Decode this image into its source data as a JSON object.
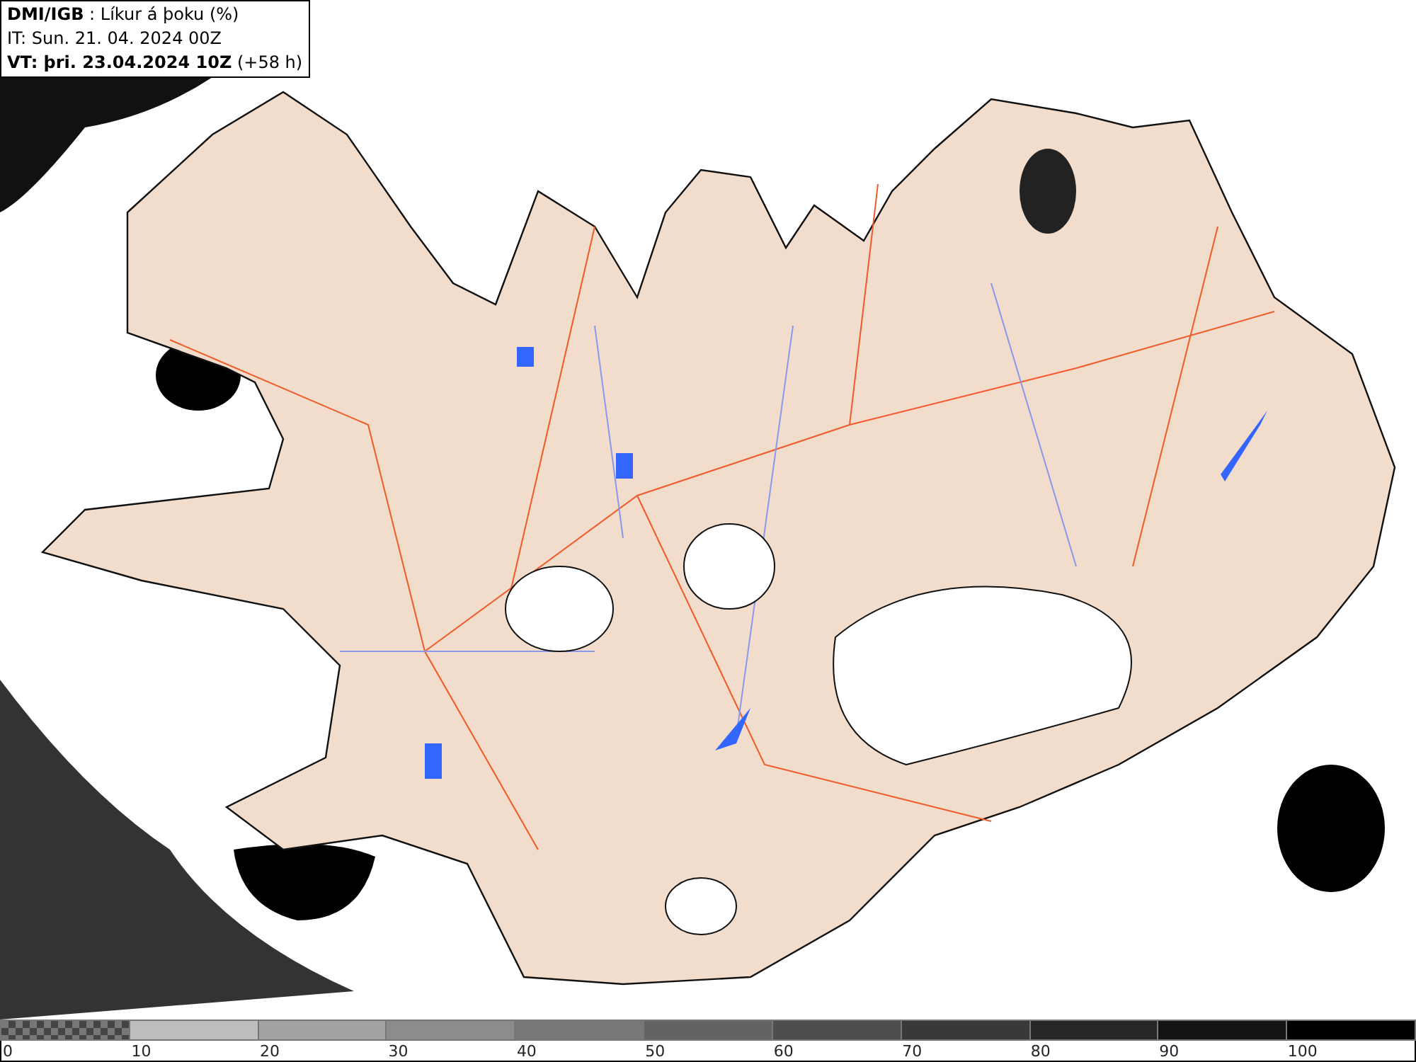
{
  "header": {
    "lines": [
      "**DMI/IGB** : Líkur á þoku (%)",
      "IT: Sun. 21. 04. 2024 00Z",
      "**VT: þri. 23.04.2024 10Z** (+58 h)"
    ]
  },
  "legend": {
    "bins": [
      {
        "kind": "checker"
      },
      {
        "kind": "solid",
        "color": "#bdbdbd"
      },
      {
        "kind": "solid",
        "color": "#a3a3a3"
      },
      {
        "kind": "solid",
        "color": "#8c8c8c"
      },
      {
        "kind": "solid",
        "color": "#787878"
      },
      {
        "kind": "solid",
        "color": "#636363"
      },
      {
        "kind": "solid",
        "color": "#4d4d4d"
      },
      {
        "kind": "solid",
        "color": "#383838"
      },
      {
        "kind": "solid",
        "color": "#262626"
      },
      {
        "kind": "solid",
        "color": "#141414"
      },
      {
        "kind": "solid",
        "color": "#000000"
      }
    ],
    "ticks": [
      "0",
      "10",
      "20",
      "30",
      "40",
      "50",
      "60",
      "70",
      "80",
      "90",
      "100"
    ]
  }
}
